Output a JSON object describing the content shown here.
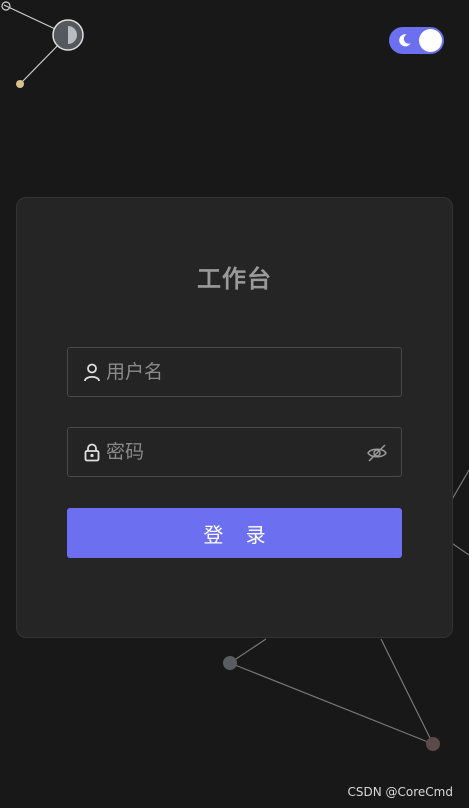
{
  "theme": {
    "accent": "#6c6ff0",
    "background": "#181818",
    "card": "#252525"
  },
  "header": {
    "theme_toggle_icon": "moon-icon",
    "theme_mode": "dark"
  },
  "login": {
    "title": "工作台",
    "username": {
      "placeholder": "用户名",
      "value": "",
      "icon": "user-icon"
    },
    "password": {
      "placeholder": "密码",
      "value": "",
      "icon": "lock-icon",
      "toggle_icon": "eye-off-icon"
    },
    "submit_label": "登 录"
  },
  "watermark": "CSDN @CoreCmd"
}
